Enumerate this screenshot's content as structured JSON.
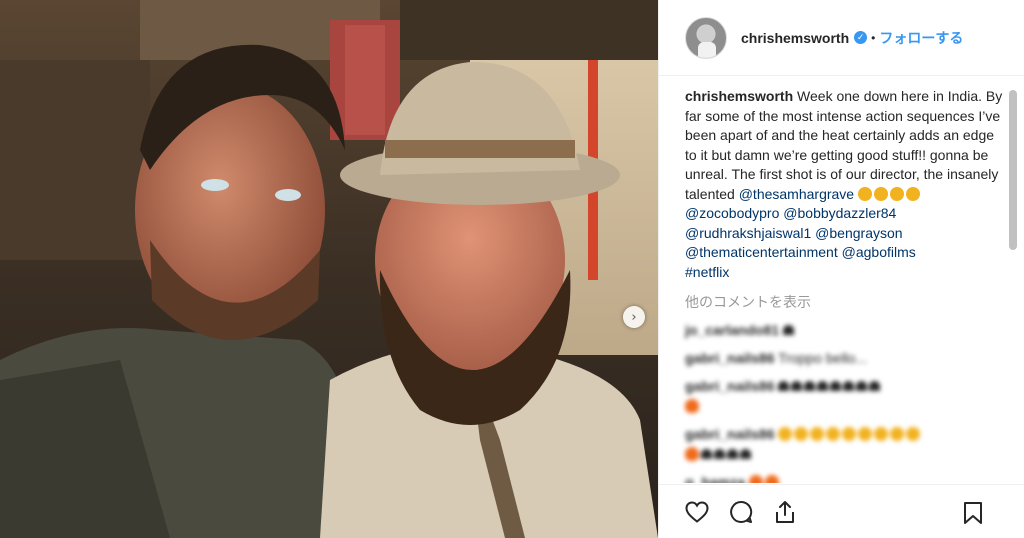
{
  "header": {
    "username": "chrishemsworth",
    "separator": "•",
    "follow_label": "フォローする"
  },
  "post": {
    "caption_author": "chrishemsworth",
    "caption_text": " Week one down here in India. By far some of the most intense action sequences I’ve been apart of and the heat certainly adds an edge to it but damn we’re getting good stuff!! gonna be unreal. The first shot is of our director, the insanely talented ",
    "mentions": [
      "@thesamhargrave",
      "@zocobodypro",
      "@bobbydazzler84",
      "@rudhrakshjaiswal1",
      "@bengrayson",
      "@thematicentertainment",
      "@agbofilms",
      "#netflix"
    ],
    "view_more_comments": "他のコメントを表示"
  },
  "comments": [
    {
      "user": "jo_carlando81",
      "text": ""
    },
    {
      "user": "gabri_nails86",
      "text": "Troppo bello..."
    },
    {
      "user": "gabri_nails86",
      "text": ""
    },
    {
      "user": "gabri_nails86",
      "text": ""
    },
    {
      "user": "g_hamza",
      "text": ""
    }
  ],
  "icons": {
    "verified": "verified-badge-icon",
    "next": "chevron-right-icon",
    "like": "heart-icon",
    "comment": "comment-bubble-icon",
    "share": "share-icon",
    "save": "bookmark-icon"
  },
  "colors": {
    "accent": "#3897f0",
    "link": "#003569",
    "muted": "#999999",
    "border": "#efefef"
  }
}
